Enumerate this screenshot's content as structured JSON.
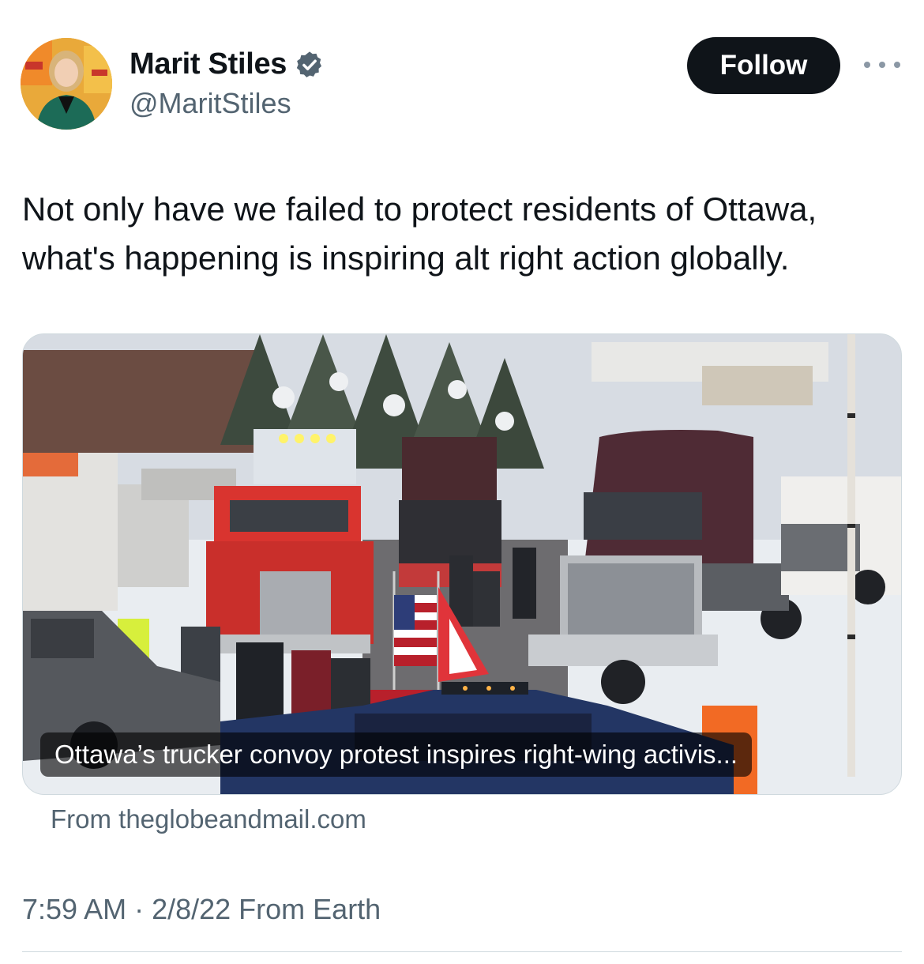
{
  "author": {
    "display_name": "Marit Stiles",
    "handle": "@MaritStiles",
    "verified": true,
    "verified_color": "#536471"
  },
  "actions": {
    "follow_label": "Follow",
    "more_icon": "more-horizontal-icon"
  },
  "tweet": {
    "text": "Not only have we failed to protect residents of Ottawa, what's happening is inspiring alt right action globally."
  },
  "link_card": {
    "caption": "Ottawa’s trucker convoy protest inspires right-wing activis...",
    "source": "From theglobeandmail.com"
  },
  "meta": {
    "timestamp": "7:59 AM · 2/8/22 From Earth"
  },
  "colors": {
    "text_primary": "#0f1419",
    "text_secondary": "#536471",
    "follow_bg": "#0f1419",
    "border": "#cfd9de"
  }
}
